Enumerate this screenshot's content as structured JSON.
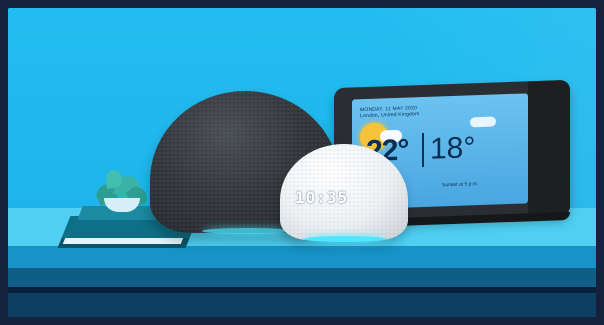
{
  "banner": {
    "alt": "Amazon Echo devices on a shelf"
  },
  "echo_show": {
    "location": "MONDAY, 11 MAY 2020\nLondon, United Kingdom",
    "temp_current": "22°",
    "temp_low": "18°",
    "footer": "Sunset at 5 p.m."
  },
  "echo_dot": {
    "clock": "10:35"
  },
  "colors": {
    "background": "#1fb6ec",
    "shelf": "#4fd0f3",
    "shelf_dark": "#0f5e86",
    "light_ring": "#4fe6ff"
  }
}
